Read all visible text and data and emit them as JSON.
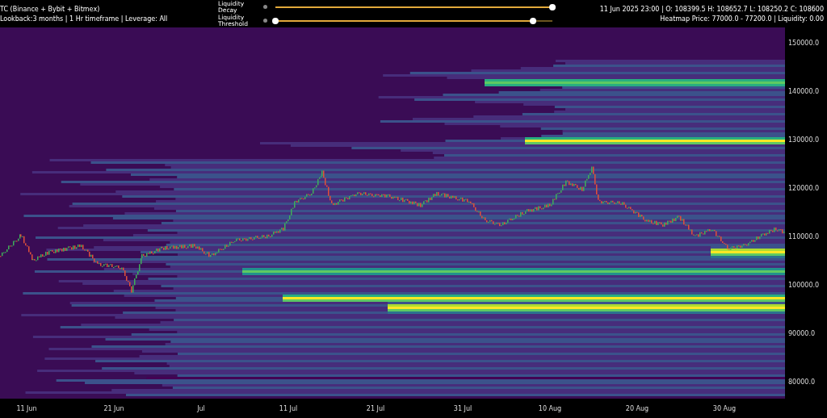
{
  "header": {
    "title": "TC (Binance + Bybit + Bitmex)",
    "subtitle": "Lookback:3 months | 1 Hr timeframe | Leverage: All",
    "sliders": [
      {
        "label": "Liquidity Decay",
        "thumbs": [
          {
            "level": 1.0
          }
        ]
      },
      {
        "label": "Liquidity Threshold",
        "thumbs": [
          {
            "level": 0.0
          },
          {
            "level": 0.93
          }
        ]
      }
    ],
    "ohlc": "11 Jun 2025 23:00 | O: 108399.5 H: 108652.7 L: 108250.2 C: 108600",
    "heatmap_info": "Heatmap Price: 77000.0 - 77200.0 | Liquidity: 0.00"
  },
  "chart": {
    "y_axis_labels": [
      "150000.0",
      "140000.0",
      "130000.0",
      "120000.0",
      "110000.0",
      "100000.0",
      "90000.0",
      "80000.0"
    ],
    "x_axis_labels": [
      "11 Jun",
      "21 Jun",
      "Jul",
      "11 Jul",
      "21 Jul",
      "31 Jul",
      "10 Aug",
      "20 Aug",
      "30 Aug"
    ]
  }
}
